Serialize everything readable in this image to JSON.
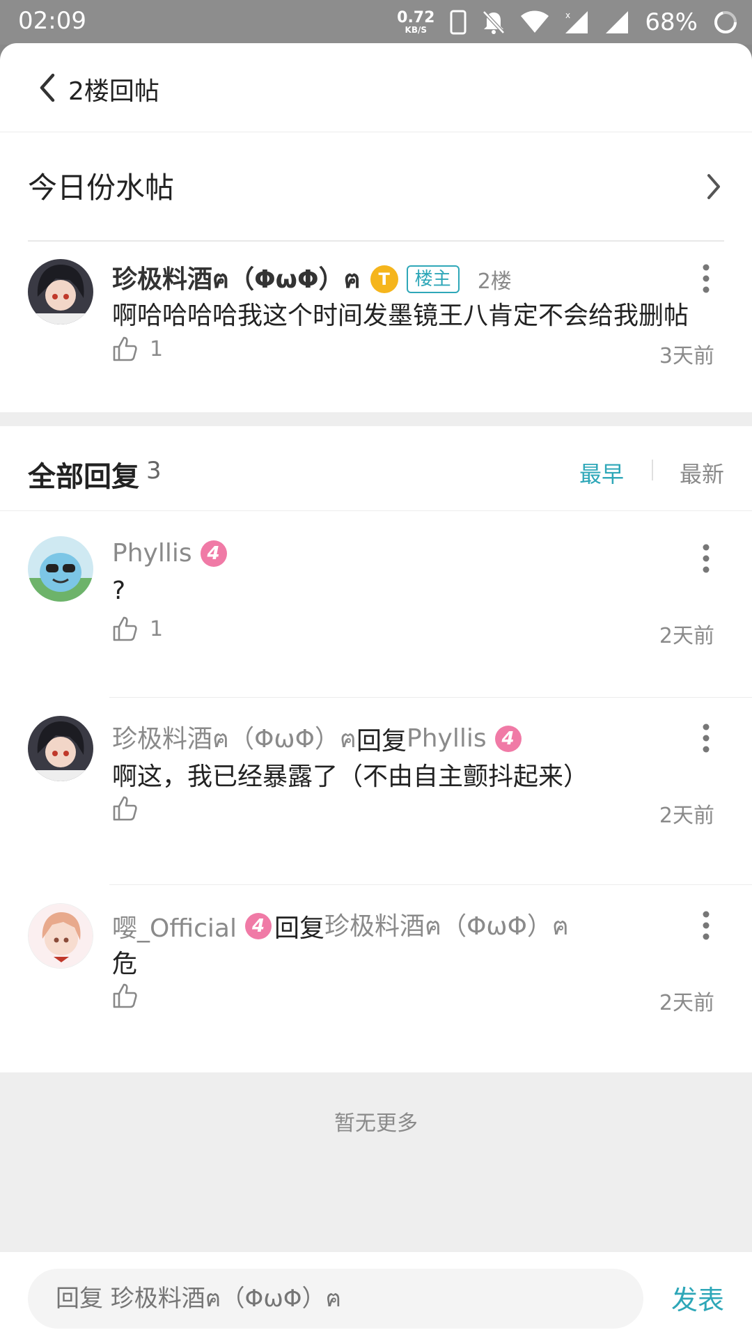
{
  "status_bar": {
    "time": "02:09",
    "speed_value": "0.72",
    "speed_unit": "KB/S",
    "battery": "68%"
  },
  "header": {
    "title": "2楼回帖"
  },
  "thread": {
    "title": "今日份水帖"
  },
  "main_post": {
    "author": "珍极料酒ฅ（ΦωΦ）ฅ",
    "t_badge": "T",
    "owner_tag": "楼主",
    "floor": "2楼",
    "content": "啊哈哈哈哈我这个时间发墨镜王八肯定不会给我删帖",
    "likes": "1",
    "time": "3天前"
  },
  "replies_section": {
    "title": "全部回复",
    "count": "3",
    "sort_earliest": "最早",
    "sort_latest": "最新"
  },
  "replies": [
    {
      "author": "Phyllis",
      "level": "4",
      "content": "?",
      "likes": "1",
      "time": "2天前"
    },
    {
      "author": "珍极料酒ฅ（ΦωΦ）ฅ",
      "reply_word": "回复",
      "reply_to": "Phyllis",
      "reply_to_level": "4",
      "content": "啊这，我已经暴露了（不由自主颤抖起来）",
      "time": "2天前"
    },
    {
      "author": "嘤_Official",
      "level": "4",
      "reply_word": "回复",
      "reply_to": "珍极料酒ฅ（ΦωΦ）ฅ",
      "content": "危",
      "time": "2天前"
    }
  ],
  "footer": {
    "no_more": "暂无更多"
  },
  "input": {
    "placeholder": "回复 珍极料酒ฅ（ΦωΦ）ฅ",
    "send_label": "发表"
  },
  "colors": {
    "accent": "#2ea7b8",
    "level_badge": "#f07aa6",
    "gold_badge": "#f5b51c"
  }
}
